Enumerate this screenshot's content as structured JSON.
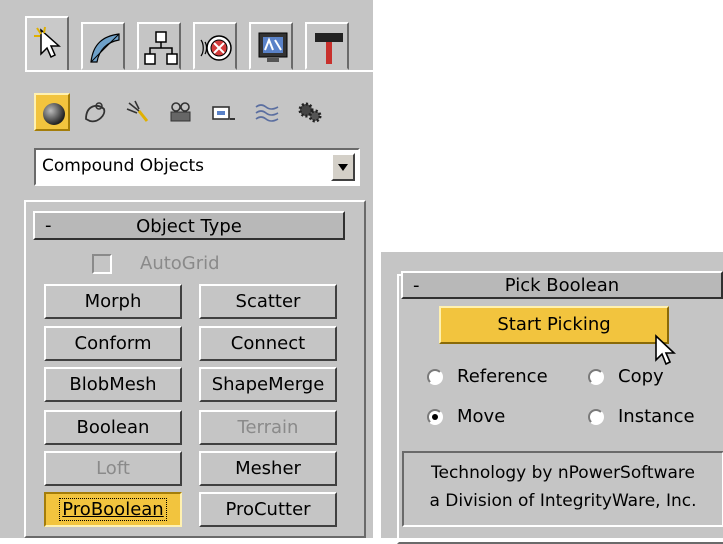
{
  "tabs": [
    {
      "icon": "create-arrow-icon",
      "active": true
    },
    {
      "icon": "modify-curve-icon",
      "active": false
    },
    {
      "icon": "hierarchy-icon",
      "active": false
    },
    {
      "icon": "motion-icon",
      "active": false
    },
    {
      "icon": "display-monitor-icon",
      "active": false
    },
    {
      "icon": "utilities-hammer-icon",
      "active": false
    }
  ],
  "categories": [
    {
      "icon": "geometry-sphere-icon",
      "active": true
    },
    {
      "icon": "shapes-icon"
    },
    {
      "icon": "lights-icon"
    },
    {
      "icon": "cameras-icon"
    },
    {
      "icon": "helpers-icon"
    },
    {
      "icon": "space-warps-icon"
    },
    {
      "icon": "systems-icon"
    }
  ],
  "dropdown": {
    "selected": "Compound Objects"
  },
  "object_type": {
    "title": "Object Type",
    "collapse": "-",
    "autogrid_label": "AutoGrid",
    "buttons": [
      "Morph",
      "Scatter",
      "Conform",
      "Connect",
      "BlobMesh",
      "ShapeMerge",
      "Boolean",
      "Terrain",
      "Loft",
      "Mesher",
      "ProBoolean",
      "ProCutter"
    ]
  },
  "pick_boolean": {
    "title": "Pick Boolean",
    "collapse": "-",
    "start_label": "Start Picking",
    "options": {
      "reference": "Reference",
      "copy": "Copy",
      "move": "Move",
      "instance": "Instance"
    },
    "selected": "Move",
    "tech_line1": "Technology by nPowerSoftware",
    "tech_line2": "a Division of IntegrityWare, Inc."
  },
  "colors": {
    "panel": "#c5c5c5",
    "accent": "#f2c43e",
    "header": "#b8b8b8"
  }
}
